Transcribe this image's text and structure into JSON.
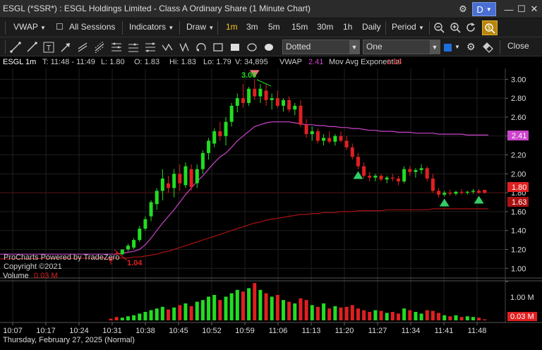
{
  "window": {
    "title": "ESGL (*SSR*) : ESGL Holdings Limited - Class A Ordinary Share (1 Minute Chart)",
    "theme_letter": "D"
  },
  "toolbar1": {
    "study_dropdown": "VWAP",
    "sessions_label": "All Sessions",
    "indicators_label": "Indicators",
    "draw_label": "Draw",
    "intervals": [
      "1m",
      "3m",
      "5m",
      "15m",
      "30m",
      "1h",
      "Daily"
    ],
    "active_interval": "1m",
    "period_label": "Period"
  },
  "toolbar2": {
    "line_style": "Dotted",
    "line_width": "One",
    "close_label": "Close"
  },
  "infobar": {
    "symbol": "ESGL 1m",
    "time": "T: 11:48 - 11:49",
    "low": "L: 1.80",
    "open": "O: 1.83",
    "high": "Hi: 1.83",
    "low2": "Lo: 1.79",
    "volume": "V: 34,895",
    "vwap_label": "VWAP",
    "vwap_value": "2.41",
    "ema_label": "Mov Avg Exponential",
    "ema_value": "1.63"
  },
  "colors": {
    "up": "#22dd22",
    "down": "#e02020",
    "vwap": "#cc44cc",
    "ema": "#aa1111",
    "active": "#f5c518"
  },
  "chart_data": {
    "type": "candlestick",
    "ylim": [
      0.95,
      3.1
    ],
    "y_ticks": [
      "3.00",
      "2.80",
      "2.60",
      "2.40",
      "2.20",
      "2.00",
      "1.80",
      "1.60",
      "1.40",
      "1.20",
      "1.00"
    ],
    "x_ticks": [
      "10:07",
      "10:17",
      "10:24",
      "10:31",
      "10:38",
      "10:45",
      "10:52",
      "10:59",
      "11:06",
      "11:13",
      "11:20",
      "11:27",
      "11:34",
      "11:41",
      "11:48"
    ],
    "date_label": "Thursday, February 27, 2025 (Normal)",
    "high_annotation": "3.00",
    "low_annotation": "1.04",
    "watermark": [
      "ProCharts Powered by TradeZero",
      "Copyright ©2021"
    ],
    "price_labels": {
      "vwap": "2.41",
      "last": "1.80",
      "ema": "1.63"
    },
    "volume": {
      "label": "Volume",
      "value": "0.03 M",
      "axis_tick": "1.00 M",
      "last": "0.03 M"
    },
    "candles": [
      {
        "o": 1.1,
        "h": 1.12,
        "l": 1.04,
        "c": 1.08
      },
      {
        "o": 1.16,
        "h": 1.18,
        "l": 1.14,
        "c": 1.15
      },
      {
        "o": 1.15,
        "h": 1.2,
        "l": 1.14,
        "c": 1.2
      },
      {
        "o": 1.2,
        "h": 1.26,
        "l": 1.18,
        "c": 1.24
      },
      {
        "o": 1.22,
        "h": 1.32,
        "l": 1.2,
        "c": 1.3
      },
      {
        "o": 1.3,
        "h": 1.45,
        "l": 1.28,
        "c": 1.42
      },
      {
        "o": 1.42,
        "h": 1.55,
        "l": 1.4,
        "c": 1.52
      },
      {
        "o": 1.55,
        "h": 1.72,
        "l": 1.5,
        "c": 1.7
      },
      {
        "o": 1.68,
        "h": 1.85,
        "l": 1.62,
        "c": 1.82
      },
      {
        "o": 1.82,
        "h": 2.05,
        "l": 1.72,
        "c": 1.95
      },
      {
        "o": 1.9,
        "h": 1.98,
        "l": 1.8,
        "c": 1.85
      },
      {
        "o": 1.85,
        "h": 2.05,
        "l": 1.75,
        "c": 2.0
      },
      {
        "o": 2.0,
        "h": 2.1,
        "l": 1.82,
        "c": 1.9
      },
      {
        "o": 1.88,
        "h": 2.12,
        "l": 1.85,
        "c": 2.08
      },
      {
        "o": 2.05,
        "h": 2.1,
        "l": 1.82,
        "c": 1.86
      },
      {
        "o": 1.9,
        "h": 2.1,
        "l": 1.85,
        "c": 2.05
      },
      {
        "o": 2.05,
        "h": 2.25,
        "l": 2.0,
        "c": 2.22
      },
      {
        "o": 2.22,
        "h": 2.38,
        "l": 2.15,
        "c": 2.35
      },
      {
        "o": 2.32,
        "h": 2.48,
        "l": 2.28,
        "c": 2.45
      },
      {
        "o": 2.45,
        "h": 2.55,
        "l": 2.35,
        "c": 2.4
      },
      {
        "o": 2.4,
        "h": 2.6,
        "l": 2.3,
        "c": 2.55
      },
      {
        "o": 2.55,
        "h": 2.75,
        "l": 2.5,
        "c": 2.72
      },
      {
        "o": 2.72,
        "h": 2.85,
        "l": 2.65,
        "c": 2.8
      },
      {
        "o": 2.8,
        "h": 2.95,
        "l": 2.7,
        "c": 2.75
      },
      {
        "o": 2.75,
        "h": 2.92,
        "l": 2.72,
        "c": 2.9
      },
      {
        "o": 2.9,
        "h": 3.0,
        "l": 2.78,
        "c": 2.82
      },
      {
        "o": 2.82,
        "h": 2.95,
        "l": 2.75,
        "c": 2.9
      },
      {
        "o": 2.88,
        "h": 2.95,
        "l": 2.72,
        "c": 2.78
      },
      {
        "o": 2.78,
        "h": 2.85,
        "l": 2.68,
        "c": 2.8
      },
      {
        "o": 2.8,
        "h": 2.88,
        "l": 2.7,
        "c": 2.72
      },
      {
        "o": 2.72,
        "h": 2.8,
        "l": 2.66,
        "c": 2.78
      },
      {
        "o": 2.78,
        "h": 2.82,
        "l": 2.65,
        "c": 2.68
      },
      {
        "o": 2.68,
        "h": 2.75,
        "l": 2.62,
        "c": 2.72
      },
      {
        "o": 2.72,
        "h": 2.78,
        "l": 2.5,
        "c": 2.52
      },
      {
        "o": 2.52,
        "h": 2.58,
        "l": 2.38,
        "c": 2.42
      },
      {
        "o": 2.42,
        "h": 2.5,
        "l": 2.35,
        "c": 2.45
      },
      {
        "o": 2.45,
        "h": 2.48,
        "l": 2.32,
        "c": 2.35
      },
      {
        "o": 2.35,
        "h": 2.42,
        "l": 2.3,
        "c": 2.38
      },
      {
        "o": 2.38,
        "h": 2.45,
        "l": 2.32,
        "c": 2.34
      },
      {
        "o": 2.34,
        "h": 2.42,
        "l": 2.3,
        "c": 2.4
      },
      {
        "o": 2.4,
        "h": 2.45,
        "l": 2.33,
        "c": 2.35
      },
      {
        "o": 2.35,
        "h": 2.4,
        "l": 2.25,
        "c": 2.28
      },
      {
        "o": 2.28,
        "h": 2.32,
        "l": 2.15,
        "c": 2.18
      },
      {
        "o": 2.18,
        "h": 2.22,
        "l": 2.05,
        "c": 2.08
      },
      {
        "o": 2.08,
        "h": 2.12,
        "l": 1.95,
        "c": 1.98
      },
      {
        "o": 1.98,
        "h": 2.02,
        "l": 1.92,
        "c": 1.96
      },
      {
        "o": 1.96,
        "h": 2.0,
        "l": 1.92,
        "c": 1.98
      },
      {
        "o": 1.98,
        "h": 2.0,
        "l": 1.92,
        "c": 1.94
      },
      {
        "o": 1.94,
        "h": 1.98,
        "l": 1.9,
        "c": 1.96
      },
      {
        "o": 1.96,
        "h": 2.0,
        "l": 1.92,
        "c": 1.95
      },
      {
        "o": 1.95,
        "h": 1.98,
        "l": 1.88,
        "c": 1.92
      },
      {
        "o": 1.92,
        "h": 2.08,
        "l": 1.9,
        "c": 2.05
      },
      {
        "o": 2.05,
        "h": 2.08,
        "l": 1.98,
        "c": 2.02
      },
      {
        "o": 2.02,
        "h": 2.06,
        "l": 1.96,
        "c": 2.04
      },
      {
        "o": 2.04,
        "h": 2.1,
        "l": 2.0,
        "c": 2.06
      },
      {
        "o": 2.06,
        "h": 2.08,
        "l": 1.92,
        "c": 1.95
      },
      {
        "o": 1.95,
        "h": 2.0,
        "l": 1.8,
        "c": 1.82
      },
      {
        "o": 1.82,
        "h": 1.85,
        "l": 1.75,
        "c": 1.78
      },
      {
        "o": 1.78,
        "h": 1.82,
        "l": 1.76,
        "c": 1.8
      },
      {
        "o": 1.8,
        "h": 1.83,
        "l": 1.77,
        "c": 1.79
      },
      {
        "o": 1.79,
        "h": 1.82,
        "l": 1.77,
        "c": 1.81
      },
      {
        "o": 1.81,
        "h": 1.84,
        "l": 1.78,
        "c": 1.8
      },
      {
        "o": 1.8,
        "h": 1.82,
        "l": 1.78,
        "c": 1.81
      },
      {
        "o": 1.81,
        "h": 1.84,
        "l": 1.79,
        "c": 1.82
      },
      {
        "o": 1.82,
        "h": 1.84,
        "l": 1.79,
        "c": 1.8
      },
      {
        "o": 1.83,
        "h": 1.83,
        "l": 1.79,
        "c": 1.8
      }
    ],
    "volumes": [
      0.05,
      0.1,
      0.08,
      0.12,
      0.15,
      0.2,
      0.25,
      0.3,
      0.35,
      0.4,
      0.32,
      0.38,
      0.45,
      0.5,
      0.42,
      0.55,
      0.6,
      0.7,
      0.75,
      0.6,
      0.7,
      0.8,
      0.9,
      0.85,
      0.95,
      1.1,
      0.9,
      0.8,
      0.7,
      0.75,
      0.6,
      0.55,
      0.5,
      0.65,
      0.6,
      0.45,
      0.4,
      0.5,
      0.35,
      0.42,
      0.38,
      0.4,
      0.45,
      0.35,
      0.3,
      0.25,
      0.3,
      0.28,
      0.22,
      0.25,
      0.2,
      0.35,
      0.3,
      0.25,
      0.2,
      0.3,
      0.28,
      0.22,
      0.15,
      0.12,
      0.15,
      0.1,
      0.12,
      0.1,
      0.08,
      0.03
    ],
    "vwap": [
      1.15,
      1.15,
      1.16,
      1.17,
      1.18,
      1.2,
      1.25,
      1.32,
      1.4,
      1.48,
      1.55,
      1.62,
      1.7,
      1.78,
      1.85,
      1.92,
      1.98,
      2.05,
      2.12,
      2.18,
      2.22,
      2.28,
      2.35,
      2.4,
      2.45,
      2.5,
      2.52,
      2.54,
      2.55,
      2.55,
      2.55,
      2.55,
      2.54,
      2.53,
      2.52,
      2.52,
      2.51,
      2.51,
      2.5,
      2.5,
      2.49,
      2.49,
      2.48,
      2.48,
      2.47,
      2.46,
      2.46,
      2.45,
      2.45,
      2.45,
      2.44,
      2.44,
      2.44,
      2.43,
      2.43,
      2.43,
      2.43,
      2.42,
      2.42,
      2.42,
      2.42,
      2.42,
      2.41,
      2.41,
      2.41,
      2.41
    ],
    "ema": [
      1.11,
      1.11,
      1.11,
      1.11,
      1.12,
      1.12,
      1.13,
      1.14,
      1.15,
      1.17,
      1.18,
      1.2,
      1.22,
      1.24,
      1.26,
      1.28,
      1.3,
      1.32,
      1.34,
      1.36,
      1.38,
      1.4,
      1.42,
      1.44,
      1.46,
      1.48,
      1.49,
      1.51,
      1.52,
      1.53,
      1.54,
      1.55,
      1.56,
      1.57,
      1.57,
      1.58,
      1.58,
      1.59,
      1.59,
      1.59,
      1.6,
      1.6,
      1.6,
      1.61,
      1.61,
      1.61,
      1.61,
      1.61,
      1.62,
      1.62,
      1.62,
      1.62,
      1.62,
      1.62,
      1.62,
      1.62,
      1.63,
      1.63,
      1.63,
      1.63,
      1.63,
      1.63,
      1.63,
      1.63,
      1.63,
      1.63
    ],
    "markers": [
      {
        "index": 25,
        "type": "sell"
      },
      {
        "index": 43,
        "type": "buy"
      },
      {
        "index": 58,
        "type": "buy"
      },
      {
        "index": 64,
        "type": "buy"
      }
    ]
  }
}
